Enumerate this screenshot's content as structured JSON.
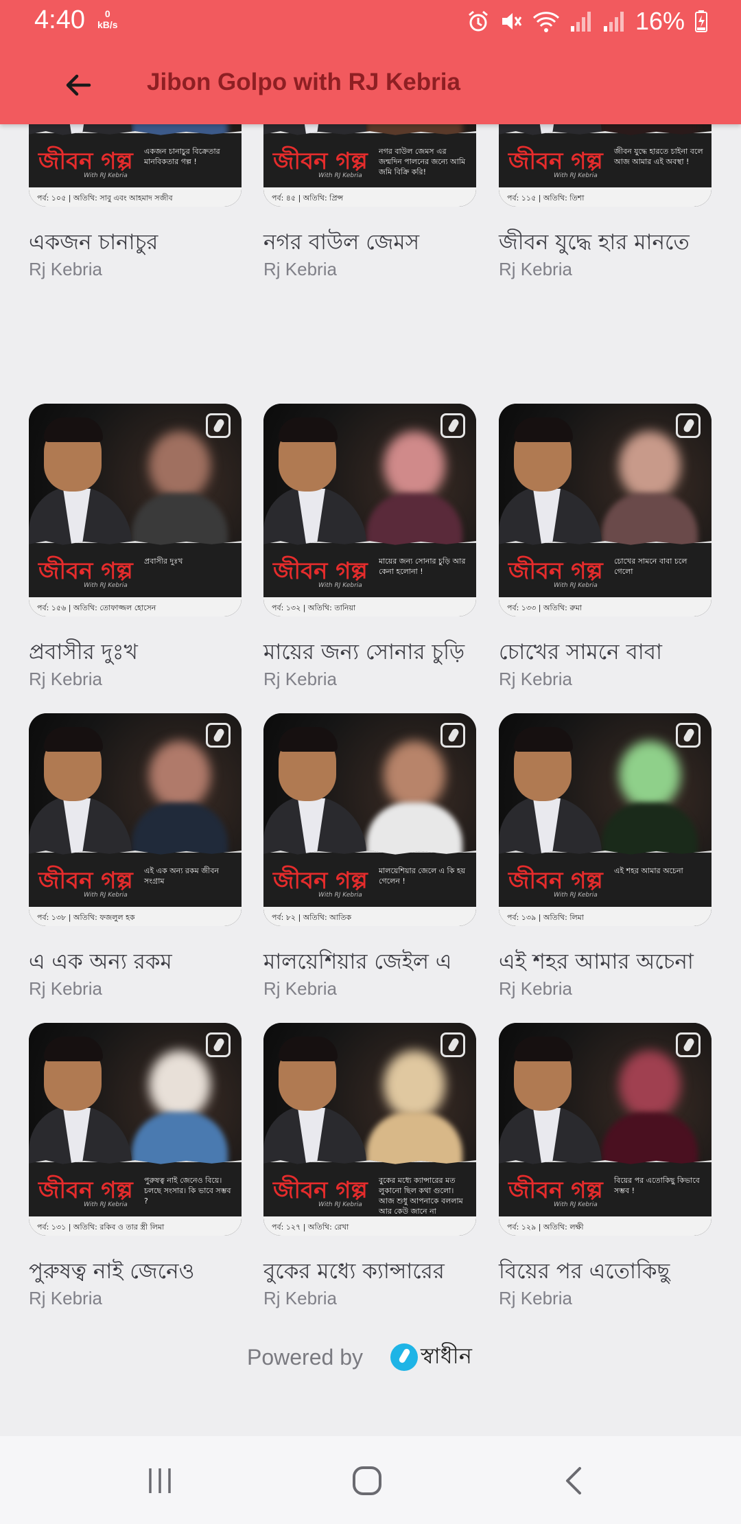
{
  "status_bar": {
    "time": "4:40",
    "net_speed_value": "0",
    "net_speed_unit": "kB/s",
    "battery": "16%"
  },
  "app_bar": {
    "title": "Jibon Golpo with RJ Kebria"
  },
  "episodes": [
    {
      "title": "একজন চানাচুর",
      "author": "Rj Kebria",
      "caption": "একজন চানাচুর বিক্রেতার মানবিকতার গল্প !",
      "footer": "পর্ব: ১০৫ | অতিথি: সাবু এবং আহমাদ সজীব",
      "guest_color": "#c9a48a",
      "guest_body_color": "#3c5a8a"
    },
    {
      "title": "নগর বাউল জেমস",
      "author": "Rj Kebria",
      "caption": "নগর বাউল জেমস এর জন্মদিন পালনের জন্যে আমি জমি বিক্রি করি!",
      "footer": "পর্ব: ৪৫ | অতিথি: প্রিন্স",
      "guest_color": "#b88a6a",
      "guest_body_color": "#5a3a2a"
    },
    {
      "title": "জীবন যুদ্ধে হার মানতে",
      "author": "Rj Kebria",
      "caption": "জীবন যুদ্ধে হারতে চাইনা বলে আজ আমার এই অবস্থা !",
      "footer": "পর্ব: ১১৫ | অতিথি: তিশা",
      "guest_color": "#a8786a",
      "guest_body_color": "#2a1a1a"
    },
    {
      "title": "প্রবাসীর দুঃখ",
      "author": "Rj Kebria",
      "caption": "প্রবাসীর দুঃখ",
      "footer": "পর্ব: ১৫৬ | অতিথি: তোফাজ্জল হোসেন",
      "guest_color": "#a07060",
      "guest_body_color": "#3a3a3a"
    },
    {
      "title": "মায়ের জন্য সোনার চুড়ি",
      "author": "Rj Kebria",
      "caption": "মায়ের জন্য সোনার চুড়ি আর কেনা হলোনা !",
      "footer": "পর্ব: ১৩২ | অতিথি: তানিয়া",
      "guest_color": "#d08a8a",
      "guest_body_color": "#5a2a3a"
    },
    {
      "title": "চোখের সামনে বাবা",
      "author": "Rj Kebria",
      "caption": "চোখের সামনে বাবা চলে গেলো",
      "footer": "পর্ব: ১৩৩ | অতিথি: রুমা",
      "guest_color": "#c89a8a",
      "guest_body_color": "#6a4a4a"
    },
    {
      "title": "এ এক অন্য রকম",
      "author": "Rj Kebria",
      "caption": "এই এক অন্য রকম জীবন সংগ্রাম",
      "footer": "পর্ব: ১৩৮ | অতিথি: ফজলুল হক",
      "guest_color": "#b07a6a",
      "guest_body_color": "#202a3a"
    },
    {
      "title": "মালয়েশিয়ার জেইল এ",
      "author": "Rj Kebria",
      "caption": "মালয়েশিয়ার জেলে এ কি হয় গেলেন !",
      "footer": "পর্ব: ৮২ | অতিথি: আতিক",
      "guest_color": "#b8846a",
      "guest_body_color": "#e8e8e8"
    },
    {
      "title": "এই শহর আমার অচেনা",
      "author": "Rj Kebria",
      "caption": "এই শহর আমার অচেনা",
      "footer": "পর্ব: ১৩৯ | অতিথি: লিমা",
      "guest_color": "#8fd08a",
      "guest_body_color": "#1a2a1a"
    },
    {
      "title": "পুরুষত্ব নাই জেনেও",
      "author": "Rj Kebria",
      "caption": "পুরুষত্ব নাই জেনেও বিয়ে। চলছে সংসার। কি ভাবে সম্ভব ?",
      "footer": "পর্ব: ১৩১ | অতিথি: রকিব ও তার স্ত্রী লিমা",
      "guest_color": "#e8e0d8",
      "guest_body_color": "#4a7ab0"
    },
    {
      "title": "বুকের মধ্যে ক্যান্সারের",
      "author": "Rj Kebria",
      "caption": "বুকের মধ্যে ক্যান্সারের মত লুকানো ছিল কথা গুলো। আজ শুধু আপনাকে বললাম আর কেউ জানে না",
      "footer": "পর্ব: ১২৭ | অতিথি: রেখা",
      "guest_color": "#e0c8a0",
      "guest_body_color": "#d8b888"
    },
    {
      "title": "বিয়ের পর এতোকিছু",
      "author": "Rj Kebria",
      "caption": "বিয়ের পর এতোকিছু কিভাবে সম্ভব !",
      "footer": "পর্ব: ১২৯ | অতিথি: লক্ষী",
      "guest_color": "#a04050",
      "guest_body_color": "#4a1020"
    }
  ],
  "thumbnail": {
    "logo_text": "জীবন গল্প",
    "logo_sub": "With RJ Kebria"
  },
  "footer": {
    "powered_by": "Powered by",
    "brand": "স্বাধীন"
  },
  "colors": {
    "app_bar": "#f25a5e",
    "title_text": "#8e1f23",
    "logo_red": "#e52c2c",
    "brand_blue": "#1eb4e6"
  },
  "icons": {
    "back": "arrow-left-icon",
    "alarm": "alarm-icon",
    "mute": "mute-icon",
    "wifi": "wifi-icon",
    "signal": "signal-icon",
    "battery": "battery-charging-icon",
    "nav_recent": "recent-apps-icon",
    "nav_home": "home-icon",
    "nav_back": "nav-back-icon"
  }
}
